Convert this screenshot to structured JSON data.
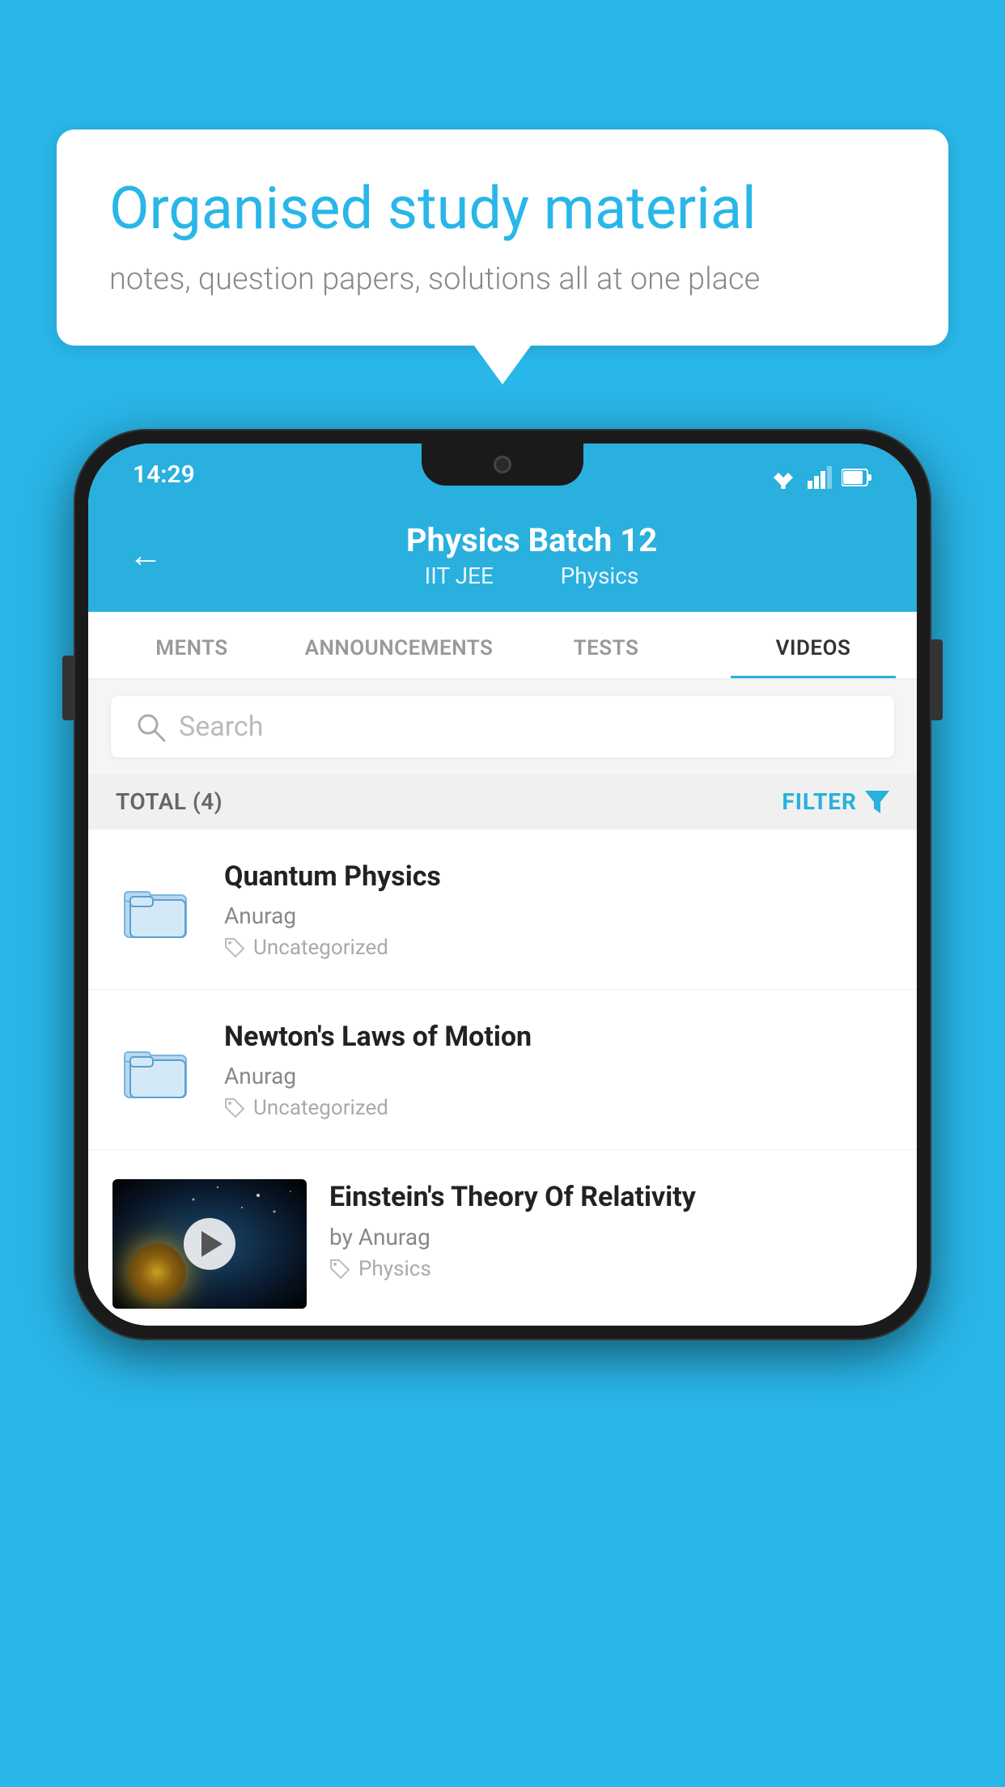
{
  "background_color": "#29b6e8",
  "speech_bubble": {
    "heading": "Organised study material",
    "subtext": "notes, question papers, solutions all at one place"
  },
  "phone": {
    "status_bar": {
      "time": "14:29"
    },
    "header": {
      "title": "Physics Batch 12",
      "subtitle_part1": "IIT JEE",
      "subtitle_part2": "Physics"
    },
    "tabs": [
      {
        "label": "MENTS",
        "active": false
      },
      {
        "label": "ANNOUNCEMENTS",
        "active": false
      },
      {
        "label": "TESTS",
        "active": false
      },
      {
        "label": "VIDEOS",
        "active": true
      }
    ],
    "search": {
      "placeholder": "Search"
    },
    "filter": {
      "total_label": "TOTAL (4)",
      "filter_label": "FILTER"
    },
    "videos": [
      {
        "id": 1,
        "title": "Quantum Physics",
        "author": "Anurag",
        "tag": "Uncategorized",
        "type": "folder"
      },
      {
        "id": 2,
        "title": "Newton's Laws of Motion",
        "author": "Anurag",
        "tag": "Uncategorized",
        "type": "folder"
      },
      {
        "id": 3,
        "title": "Einstein's Theory Of Relativity",
        "author": "by Anurag",
        "tag": "Physics",
        "type": "video"
      }
    ]
  }
}
